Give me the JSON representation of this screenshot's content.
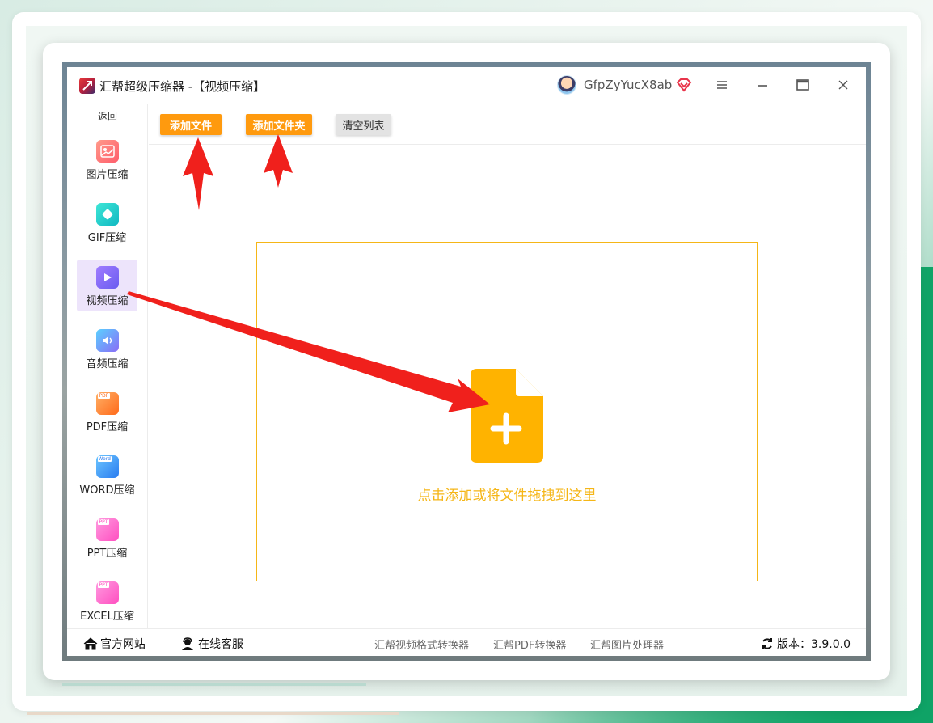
{
  "window": {
    "title": "汇帮超级压缩器  -【视频压缩】",
    "user_name": "GfpZyYucX8ab",
    "controls": [
      "menu-icon",
      "minimize-icon",
      "maximize-icon",
      "close-icon"
    ]
  },
  "sidebar": {
    "back_label": "返回",
    "items": [
      {
        "label": "图片压缩",
        "icon": "image-icon",
        "color": "#ff6f6f",
        "active": false
      },
      {
        "label": "GIF压缩",
        "icon": "gif-icon",
        "color": "#19c7c7",
        "active": false
      },
      {
        "label": "视频压缩",
        "icon": "video-play-icon",
        "color": "#8b6cf6",
        "active": true
      },
      {
        "label": "音频压缩",
        "icon": "audio-icon",
        "color": "#6a7cf6",
        "active": false
      },
      {
        "label": "PDF压缩",
        "icon": "pdf-icon",
        "color": "#ff7a1a",
        "active": false
      },
      {
        "label": "WORD压缩",
        "icon": "word-icon",
        "color": "#2f8ef7",
        "active": false
      },
      {
        "label": "PPT压缩",
        "icon": "ppt-icon",
        "color": "#ff5cc8",
        "active": false
      },
      {
        "label": "EXCEL压缩",
        "icon": "excel-icon",
        "color": "#ff5cc8",
        "active": false
      }
    ],
    "small_icon_text": {
      "pdf": "PDF",
      "word": "Word",
      "ppt": "PPT",
      "excel": "PPT"
    }
  },
  "toolbar": {
    "add_file_label": "添加文件",
    "add_folder_label": "添加文件夹",
    "clear_list_label": "清空列表"
  },
  "dropzone": {
    "hint": "点击添加或将文件拖拽到这里",
    "icon": "add-file-icon",
    "accent": "#ffb300"
  },
  "footer": {
    "official_site": "官方网站",
    "online_service": "在线客服",
    "links": [
      "汇帮视频格式转换器",
      "汇帮PDF转换器",
      "汇帮图片处理器"
    ],
    "version_label": "版本：3.9.0.0"
  },
  "colors": {
    "orange_button": "#ff9a0e",
    "annotation_arrow": "#f0201c",
    "active_sidebar_bg": "#ede4fb"
  }
}
